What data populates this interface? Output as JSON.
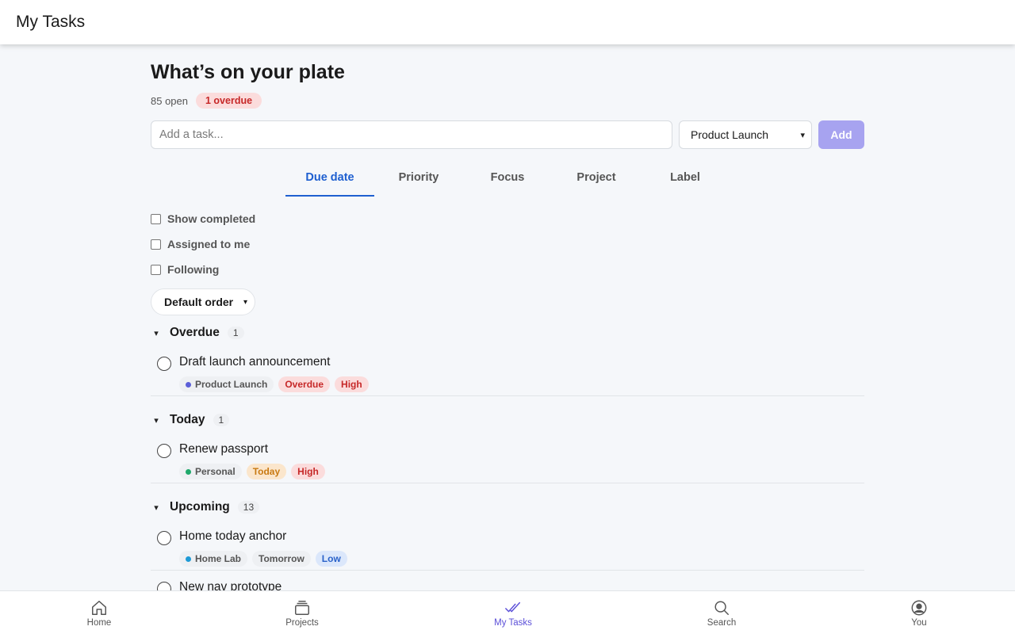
{
  "header": {
    "title": "My Tasks"
  },
  "page": {
    "heading": "What’s on your plate",
    "open_count": "85 open",
    "overdue_badge": "1 overdue"
  },
  "add_task": {
    "placeholder": "Add a task...",
    "project_selected": "Product Launch",
    "add_label": "Add"
  },
  "tabs": [
    {
      "label": "Due date",
      "active": true
    },
    {
      "label": "Priority",
      "active": false
    },
    {
      "label": "Focus",
      "active": false
    },
    {
      "label": "Project",
      "active": false
    },
    {
      "label": "Label",
      "active": false
    }
  ],
  "filters": {
    "show_completed": "Show completed",
    "assigned_to_me": "Assigned to me",
    "following": "Following"
  },
  "order": {
    "selected": "Default order"
  },
  "groups": [
    {
      "title": "Overdue",
      "count": "1",
      "tasks": [
        {
          "title": "Draft launch announcement",
          "project": "Product Launch",
          "due": "Overdue",
          "priority": "High"
        }
      ]
    },
    {
      "title": "Today",
      "count": "1",
      "tasks": [
        {
          "title": "Renew passport",
          "project": "Personal",
          "due": "Today",
          "priority": "High"
        }
      ]
    },
    {
      "title": "Upcoming",
      "count": "13",
      "tasks": [
        {
          "title": "Home today anchor",
          "project": "Home Lab",
          "due": "Tomorrow",
          "priority": "Low"
        },
        {
          "title": "New nav prototype"
        }
      ]
    }
  ],
  "colors": {
    "accent": "#1e5fd0",
    "nav_active": "#5b4fd8",
    "project_product_launch": "#5b5fd8",
    "project_personal": "#1fa86b",
    "project_home_lab": "#1e9ad6",
    "overdue_bg": "#fbdcdc",
    "overdue_fg": "#c62828",
    "today_bg": "#fbe6cc",
    "today_fg": "#c97a12",
    "low_bg": "#dbe7fb",
    "low_fg": "#2a62c9"
  },
  "nav": [
    {
      "label": "Home",
      "icon": "home-icon"
    },
    {
      "label": "Projects",
      "icon": "projects-icon"
    },
    {
      "label": "My Tasks",
      "icon": "double-check-icon",
      "active": true
    },
    {
      "label": "Search",
      "icon": "search-icon"
    },
    {
      "label": "You",
      "icon": "user-circle-icon"
    }
  ]
}
